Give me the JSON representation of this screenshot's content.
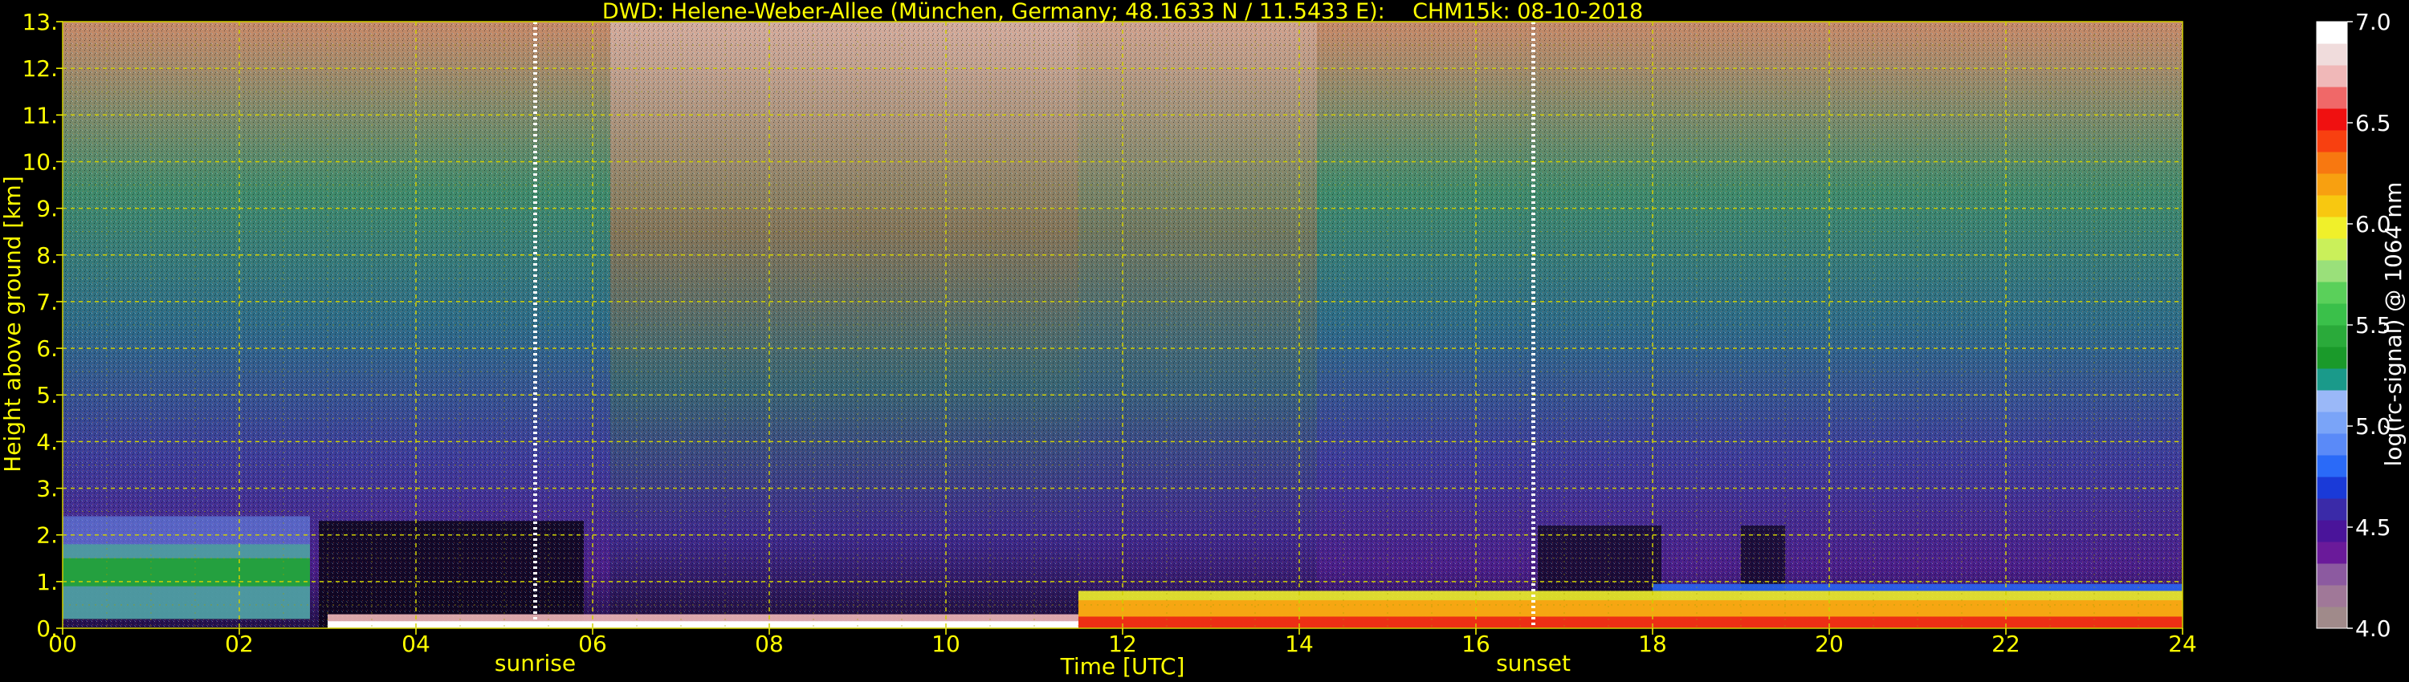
{
  "chart_data": {
    "type": "heatmap",
    "title": "DWD: Helene-Weber-Allee (München, Germany; 48.1633 N / 11.5433 E):    CHM15k: 08-10-2018",
    "xlabel": "Time [UTC]",
    "ylabel": "Height above ground [km]",
    "xlim": [
      0,
      24
    ],
    "ylim": [
      0,
      13
    ],
    "x_ticks": [
      "00",
      "02",
      "04",
      "06",
      "08",
      "10",
      "12",
      "14",
      "16",
      "18",
      "20",
      "22",
      "24"
    ],
    "y_ticks": [
      "0.",
      "1.",
      "2.",
      "3.",
      "4.",
      "5.",
      "6.",
      "7.",
      "8.",
      "9.",
      "10.",
      "11.",
      "12.",
      "13."
    ],
    "grid": true,
    "annotations": [
      {
        "label": "sunrise",
        "x": 5.35
      },
      {
        "label": "sunset",
        "x": 16.65
      }
    ],
    "colorbar": {
      "label": "log(rc-signal) @ 1064 nm",
      "range": [
        4.0,
        7.0
      ],
      "ticks": [
        "4.0",
        "4.5",
        "5.0",
        "5.5",
        "6.0",
        "6.5",
        "7.0"
      ],
      "colors": [
        "#a08a8a",
        "#a07898",
        "#8c5aa0",
        "#6a1a9a",
        "#4a149a",
        "#3a2aa8",
        "#1a3ad8",
        "#2a6af8",
        "#5a8af8",
        "#7aa4f8",
        "#9ab8f8",
        "#1a9a8a",
        "#1a9a2a",
        "#2aaa3a",
        "#3ac04a",
        "#5ad05a",
        "#9ae07a",
        "#caf05a",
        "#f0f02a",
        "#f8c810",
        "#f8a010",
        "#f87810",
        "#f84010",
        "#f01010",
        "#f06868",
        "#f0b8b8",
        "#f0dcdc",
        "#ffffff"
      ]
    },
    "features": [
      {
        "desc": "low cloud layer",
        "x": [
          0.0,
          2.8
        ],
        "y": [
          0.2,
          1.8
        ],
        "value": 5.4
      },
      {
        "desc": "boundary layer (morning)",
        "x": [
          3.0,
          11.5
        ],
        "y": [
          0.0,
          0.3
        ],
        "value": 6.8
      },
      {
        "desc": "boundary layer (afternoon)",
        "x": [
          11.5,
          24.0
        ],
        "y": [
          0.0,
          0.8
        ],
        "value": 6.0
      }
    ]
  },
  "colors": {
    "background": "#000000",
    "text": "#ffff00",
    "grid": "#d0d000",
    "marker": "#ffffff"
  }
}
